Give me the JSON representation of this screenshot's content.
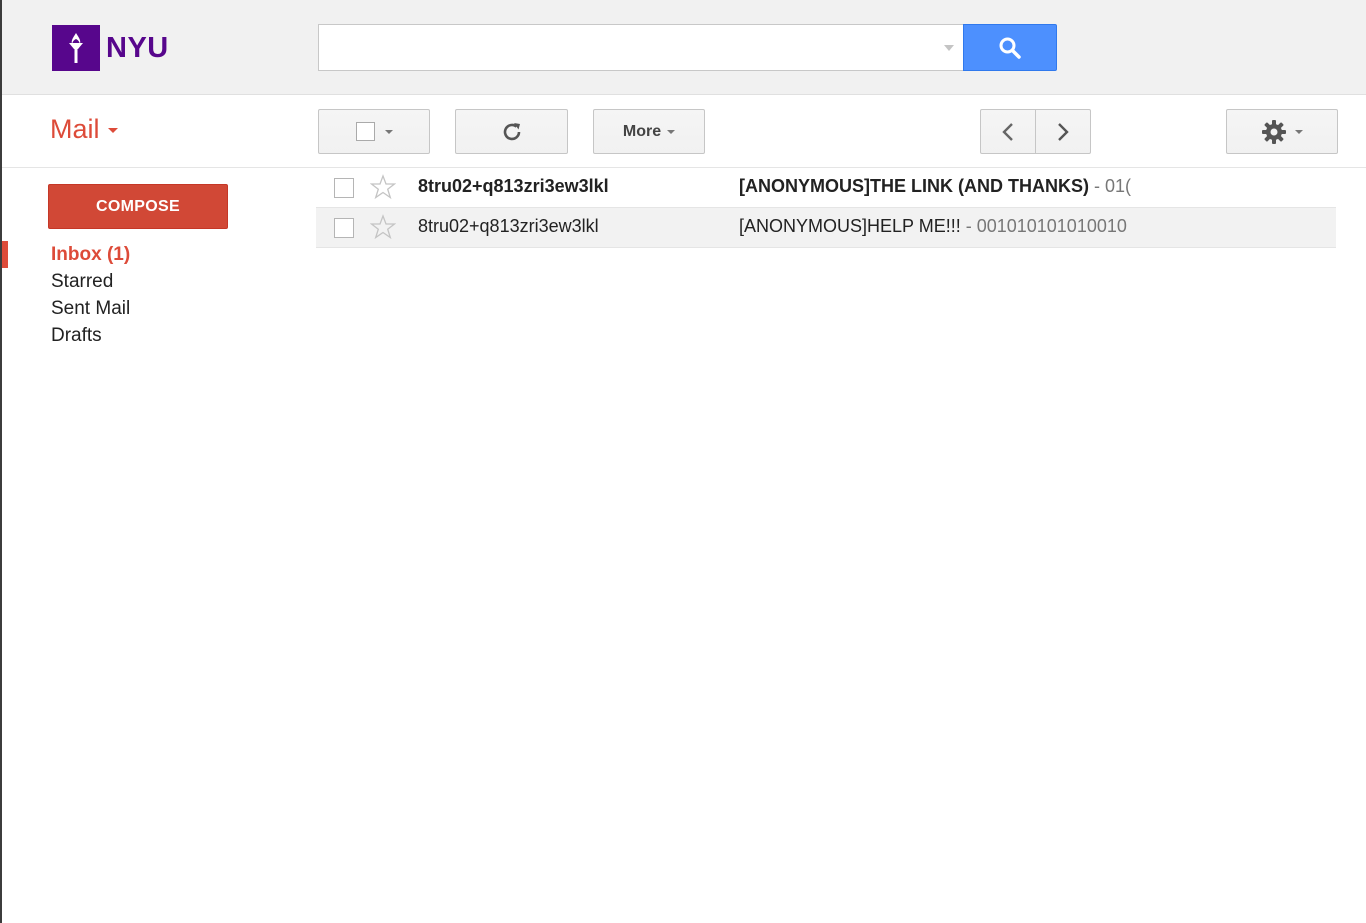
{
  "header": {
    "logo_text": "NYU",
    "search": {
      "value": "",
      "placeholder": ""
    }
  },
  "toolbar": {
    "app_title": "Mail",
    "more_label": "More"
  },
  "sidebar": {
    "compose_label": "COMPOSE",
    "items": [
      {
        "label": "Inbox (1)",
        "active": true
      },
      {
        "label": "Starred",
        "active": false
      },
      {
        "label": "Sent Mail",
        "active": false
      },
      {
        "label": "Drafts",
        "active": false
      }
    ]
  },
  "messages": [
    {
      "sender": "8tru02+q813zri3ew3lkl",
      "subject": "[ANONYMOUS]THE LINK (AND THANKS)",
      "snippet": " - 01(",
      "unread": true
    },
    {
      "sender": "8tru02+q813zri3ew3lkl",
      "subject": "[ANONYMOUS]HELP ME!!!",
      "snippet": " - 001010101010010",
      "unread": false
    }
  ],
  "colors": {
    "brand_purple": "#57068c",
    "accent_red": "#dd4b39",
    "compose_red": "#d14836",
    "search_blue": "#4d90fe"
  },
  "icons": {
    "logo": "nyu-torch-icon",
    "search": "search-icon",
    "refresh": "refresh-icon",
    "prev": "chevron-left-icon",
    "next": "chevron-right-icon",
    "settings": "gear-icon",
    "star": "star-icon"
  }
}
